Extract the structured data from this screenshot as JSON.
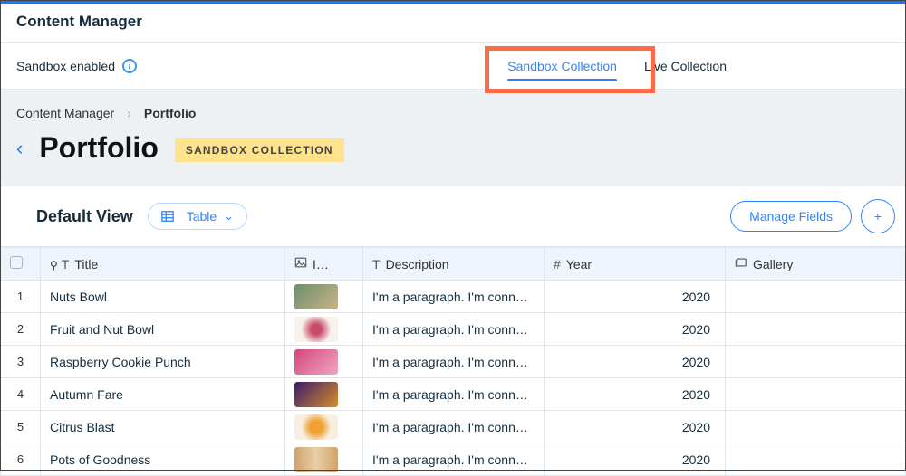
{
  "app_title": "Content Manager",
  "sandbox_status": "Sandbox enabled",
  "tabs": {
    "sandbox": "Sandbox Collection",
    "live": "Live Collection"
  },
  "breadcrumb": {
    "root": "Content Manager",
    "current": "Portfolio"
  },
  "page_title": "Portfolio",
  "badge": "SANDBOX COLLECTION",
  "view": {
    "name": "Default View",
    "layout_btn": "Table"
  },
  "actions": {
    "manage_fields": "Manage Fields"
  },
  "columns": {
    "title": "Title",
    "image": "I…",
    "description": "Description",
    "year": "Year",
    "gallery": "Gallery"
  },
  "rows": [
    {
      "idx": "1",
      "title": "Nuts Bowl",
      "desc": "I'm a paragraph. I'm conn…",
      "year": "2020",
      "thumb": "linear-gradient(135deg,#6b8e6b,#c9b48a)"
    },
    {
      "idx": "2",
      "title": "Fruit and Nut Bowl",
      "desc": "I'm a paragraph. I'm conn…",
      "year": "2020",
      "thumb": "radial-gradient(circle at 50% 50%, #c94b6b 20%, #f7f2ec 60%)"
    },
    {
      "idx": "3",
      "title": "Raspberry Cookie Punch",
      "desc": "I'm a paragraph. I'm conn…",
      "year": "2020",
      "thumb": "linear-gradient(135deg,#d4467a,#f0a6c2)"
    },
    {
      "idx": "4",
      "title": "Autumn Fare",
      "desc": "I'm a paragraph. I'm conn…",
      "year": "2020",
      "thumb": "linear-gradient(135deg,#3a1c6b,#d98c2b)"
    },
    {
      "idx": "5",
      "title": "Citrus Blast",
      "desc": "I'm a paragraph. I'm conn…",
      "year": "2020",
      "thumb": "radial-gradient(circle at 50% 50%, #f0a133 25%, #f6efe2 60%)"
    },
    {
      "idx": "6",
      "title": "Pots of Goodness",
      "desc": "I'm a paragraph. I'm conn…",
      "year": "2020",
      "thumb": "linear-gradient(90deg,#d1a16b,#e9d0a8,#d1a16b)"
    }
  ]
}
